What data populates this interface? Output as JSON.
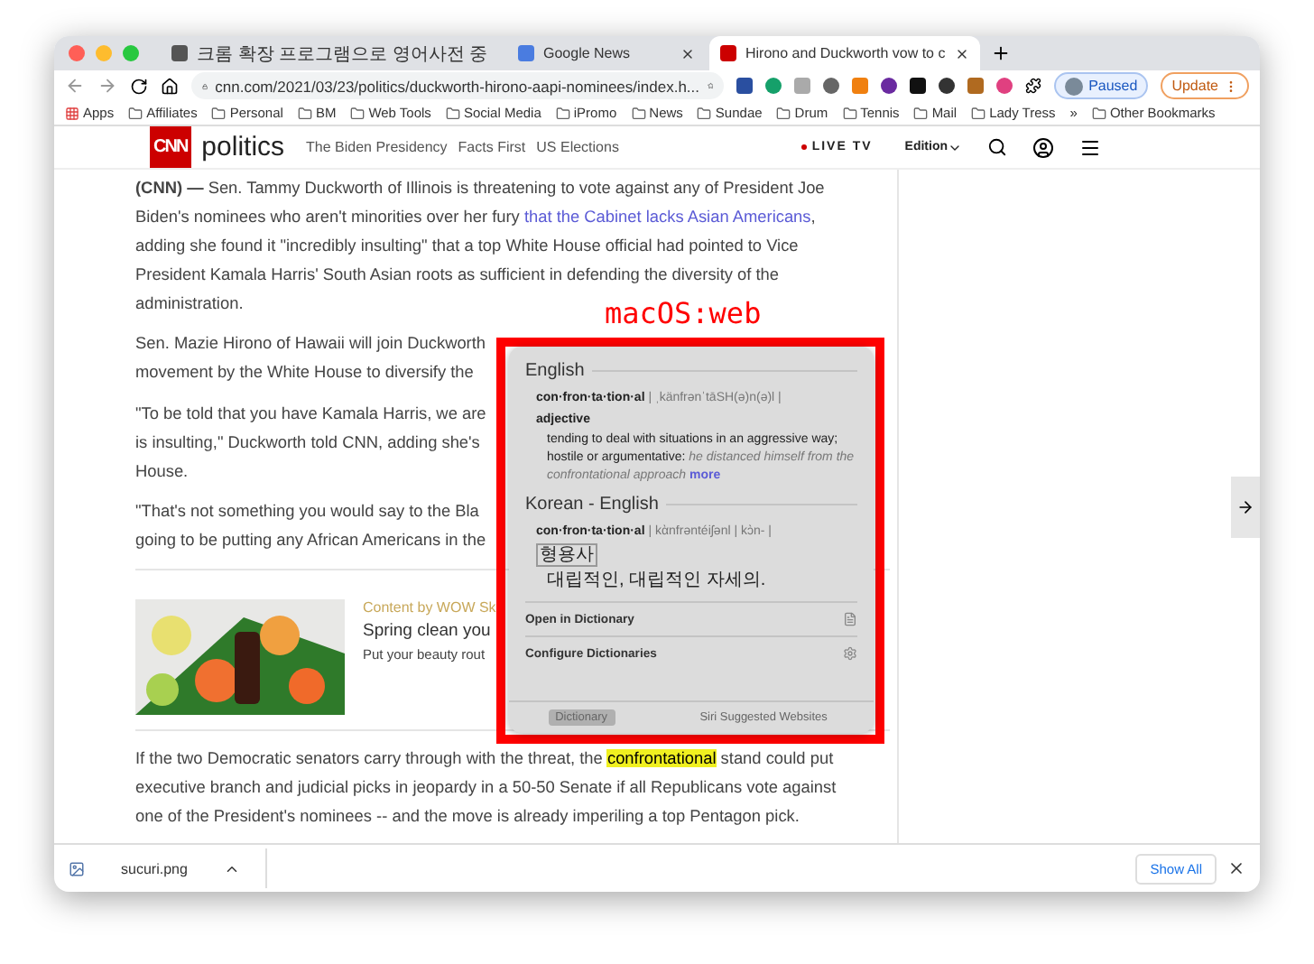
{
  "browser": {
    "tabs": [
      {
        "title": "크롬 확장 프로그램으로 영어사전 중",
        "selected": false
      },
      {
        "title": "Google News",
        "selected": false
      },
      {
        "title": "Hirono and Duckworth vow to c",
        "selected": true
      }
    ],
    "url": "cnn.com/2021/03/23/politics/duckworth-hirono-aapi-nominees/index.h...",
    "profile": "Paused",
    "update": "Update",
    "bookmarks": [
      "Apps",
      "Affiliates",
      "Personal",
      "BM",
      "Web Tools",
      "Social Media",
      "iPromo",
      "News",
      "Sundae",
      "Drum",
      "Tennis",
      "Mail",
      "Lady Tress"
    ],
    "more_bookmarks": "»",
    "other_bookmarks": "Other Bookmarks"
  },
  "site_nav": {
    "logo": "CNN",
    "section": "politics",
    "links": [
      "The Biden Presidency",
      "Facts First",
      "US Elections"
    ],
    "live": "LIVE TV",
    "edition": "Edition"
  },
  "article": {
    "paragraphs": [
      {
        "lines": [
          {
            "text": "**(CNN) —** Sen. Tammy Duckworth of Illinois is threatening to vote against any of President Joe"
          },
          {
            "text": "Biden's nominees who aren't minorities over her fury ",
            "link": "that the Cabinet lacks Asian Americans",
            "tail": ","
          },
          {
            "text": "adding she found it \"incredibly insulting\" that a top White House official had pointed to Vice"
          },
          {
            "text": "President Kamala Harris' South Asian roots as sufficient in defending the diversity of the"
          },
          {
            "text": "administration."
          }
        ]
      },
      {
        "lines": [
          {
            "text": "Sen. Mazie Hirono of Hawaii will join Duckworth"
          },
          {
            "text": "movement by the White House to diversify the"
          }
        ]
      },
      {
        "lines": [
          {
            "text": "\"To be told that you have Kamala Harris, we are"
          },
          {
            "text": "is insulting,\" Duckworth told CNN, adding she's"
          },
          {
            "text": "House."
          }
        ]
      },
      {
        "lines": [
          {
            "text": "\"That's not something you would say to the Bla"
          },
          {
            "text": "going to be putting any African Americans in the"
          }
        ]
      }
    ],
    "ad": {
      "sponsor": "Content by WOW Sk",
      "headline": "Spring clean you",
      "teaser": "Put your beauty rout"
    },
    "after": [
      {
        "text": "If the two Democratic senators carry through with the threat, the ",
        "highlight": "confrontational",
        "tail": " stand could put"
      },
      {
        "text": "executive branch and judicial picks in jeopardy in a 50-50 Senate if all Republicans vote against"
      },
      {
        "text": "one of the President's nominees -- and the move is already imperiling a top Pentagon pick."
      }
    ]
  },
  "annotation": "macOS:web",
  "lookup": {
    "sections": [
      {
        "title": "English",
        "headword": "con·fron·ta·tion·al",
        "pronunciation": "| ˌkänfrənˈtāSH(ə)n(ə)l |",
        "pos": "adjective",
        "definition": "tending to deal with situations in an aggressive way; hostile or argumentative:",
        "example": "he distanced himself from the confrontational approach",
        "more": "more"
      },
      {
        "title": "Korean - English",
        "headword": "con·fron·ta·tion·al",
        "pronunciation": "| kὰnfrəntéiʃənl | kɔ̀n- |",
        "pos": "형용사",
        "definition": "대립적인, 대립적인 자세의."
      }
    ],
    "actions": [
      "Open in Dictionary",
      "Configure Dictionaries"
    ],
    "tabs": [
      {
        "label": "Dictionary",
        "selected": true
      },
      {
        "label": "Siri Suggested Websites",
        "selected": false
      }
    ]
  },
  "downloads": {
    "file": "sucuri.png",
    "show_all": "Show All"
  }
}
